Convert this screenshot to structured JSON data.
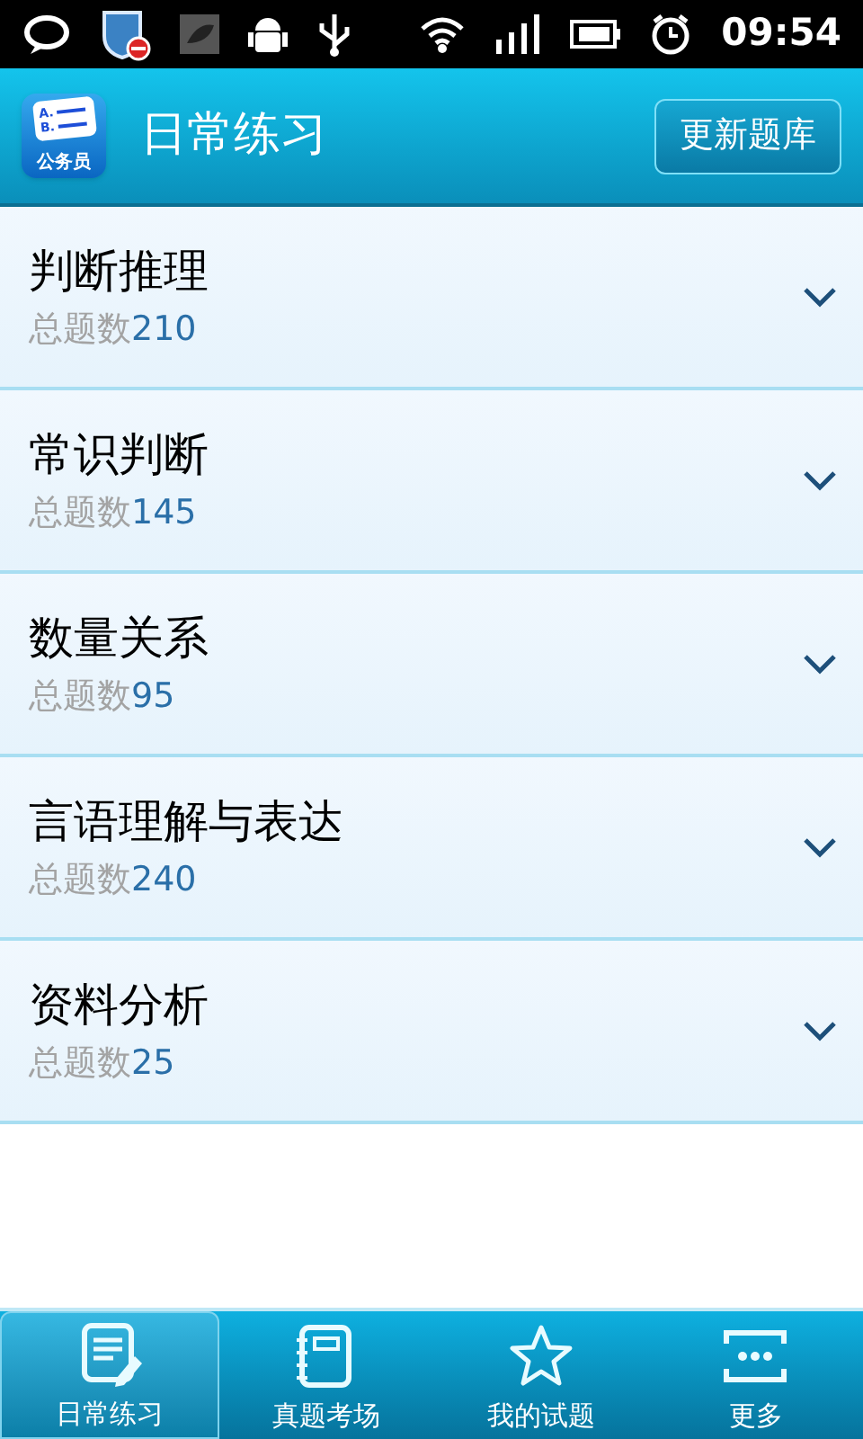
{
  "status_bar": {
    "time": "09:54"
  },
  "header": {
    "logo": {
      "options": [
        "A.",
        "B."
      ],
      "label": "公务员"
    },
    "title": "日常练习",
    "button": "更新题库"
  },
  "categories": [
    {
      "title": "判断推理",
      "count_label": "总题数",
      "count": "210",
      "expanded": false
    },
    {
      "title": "常识判断",
      "count_label": "总题数",
      "count": "145",
      "expanded": false
    },
    {
      "title": "数量关系",
      "count_label": "总题数",
      "count": "95",
      "expanded": false
    },
    {
      "title": "言语理解与表达",
      "count_label": "总题数",
      "count": "240",
      "expanded": false
    },
    {
      "title": "资料分析",
      "count_label": "总题数",
      "count": "25",
      "expanded": false
    }
  ],
  "tabs": [
    {
      "label": "日常练习",
      "kind": "notes",
      "selected": true
    },
    {
      "label": "真题考场",
      "kind": "notebook",
      "selected": false
    },
    {
      "label": "我的试题",
      "kind": "star",
      "selected": false
    },
    {
      "label": "更多",
      "kind": "more",
      "selected": false
    }
  ]
}
